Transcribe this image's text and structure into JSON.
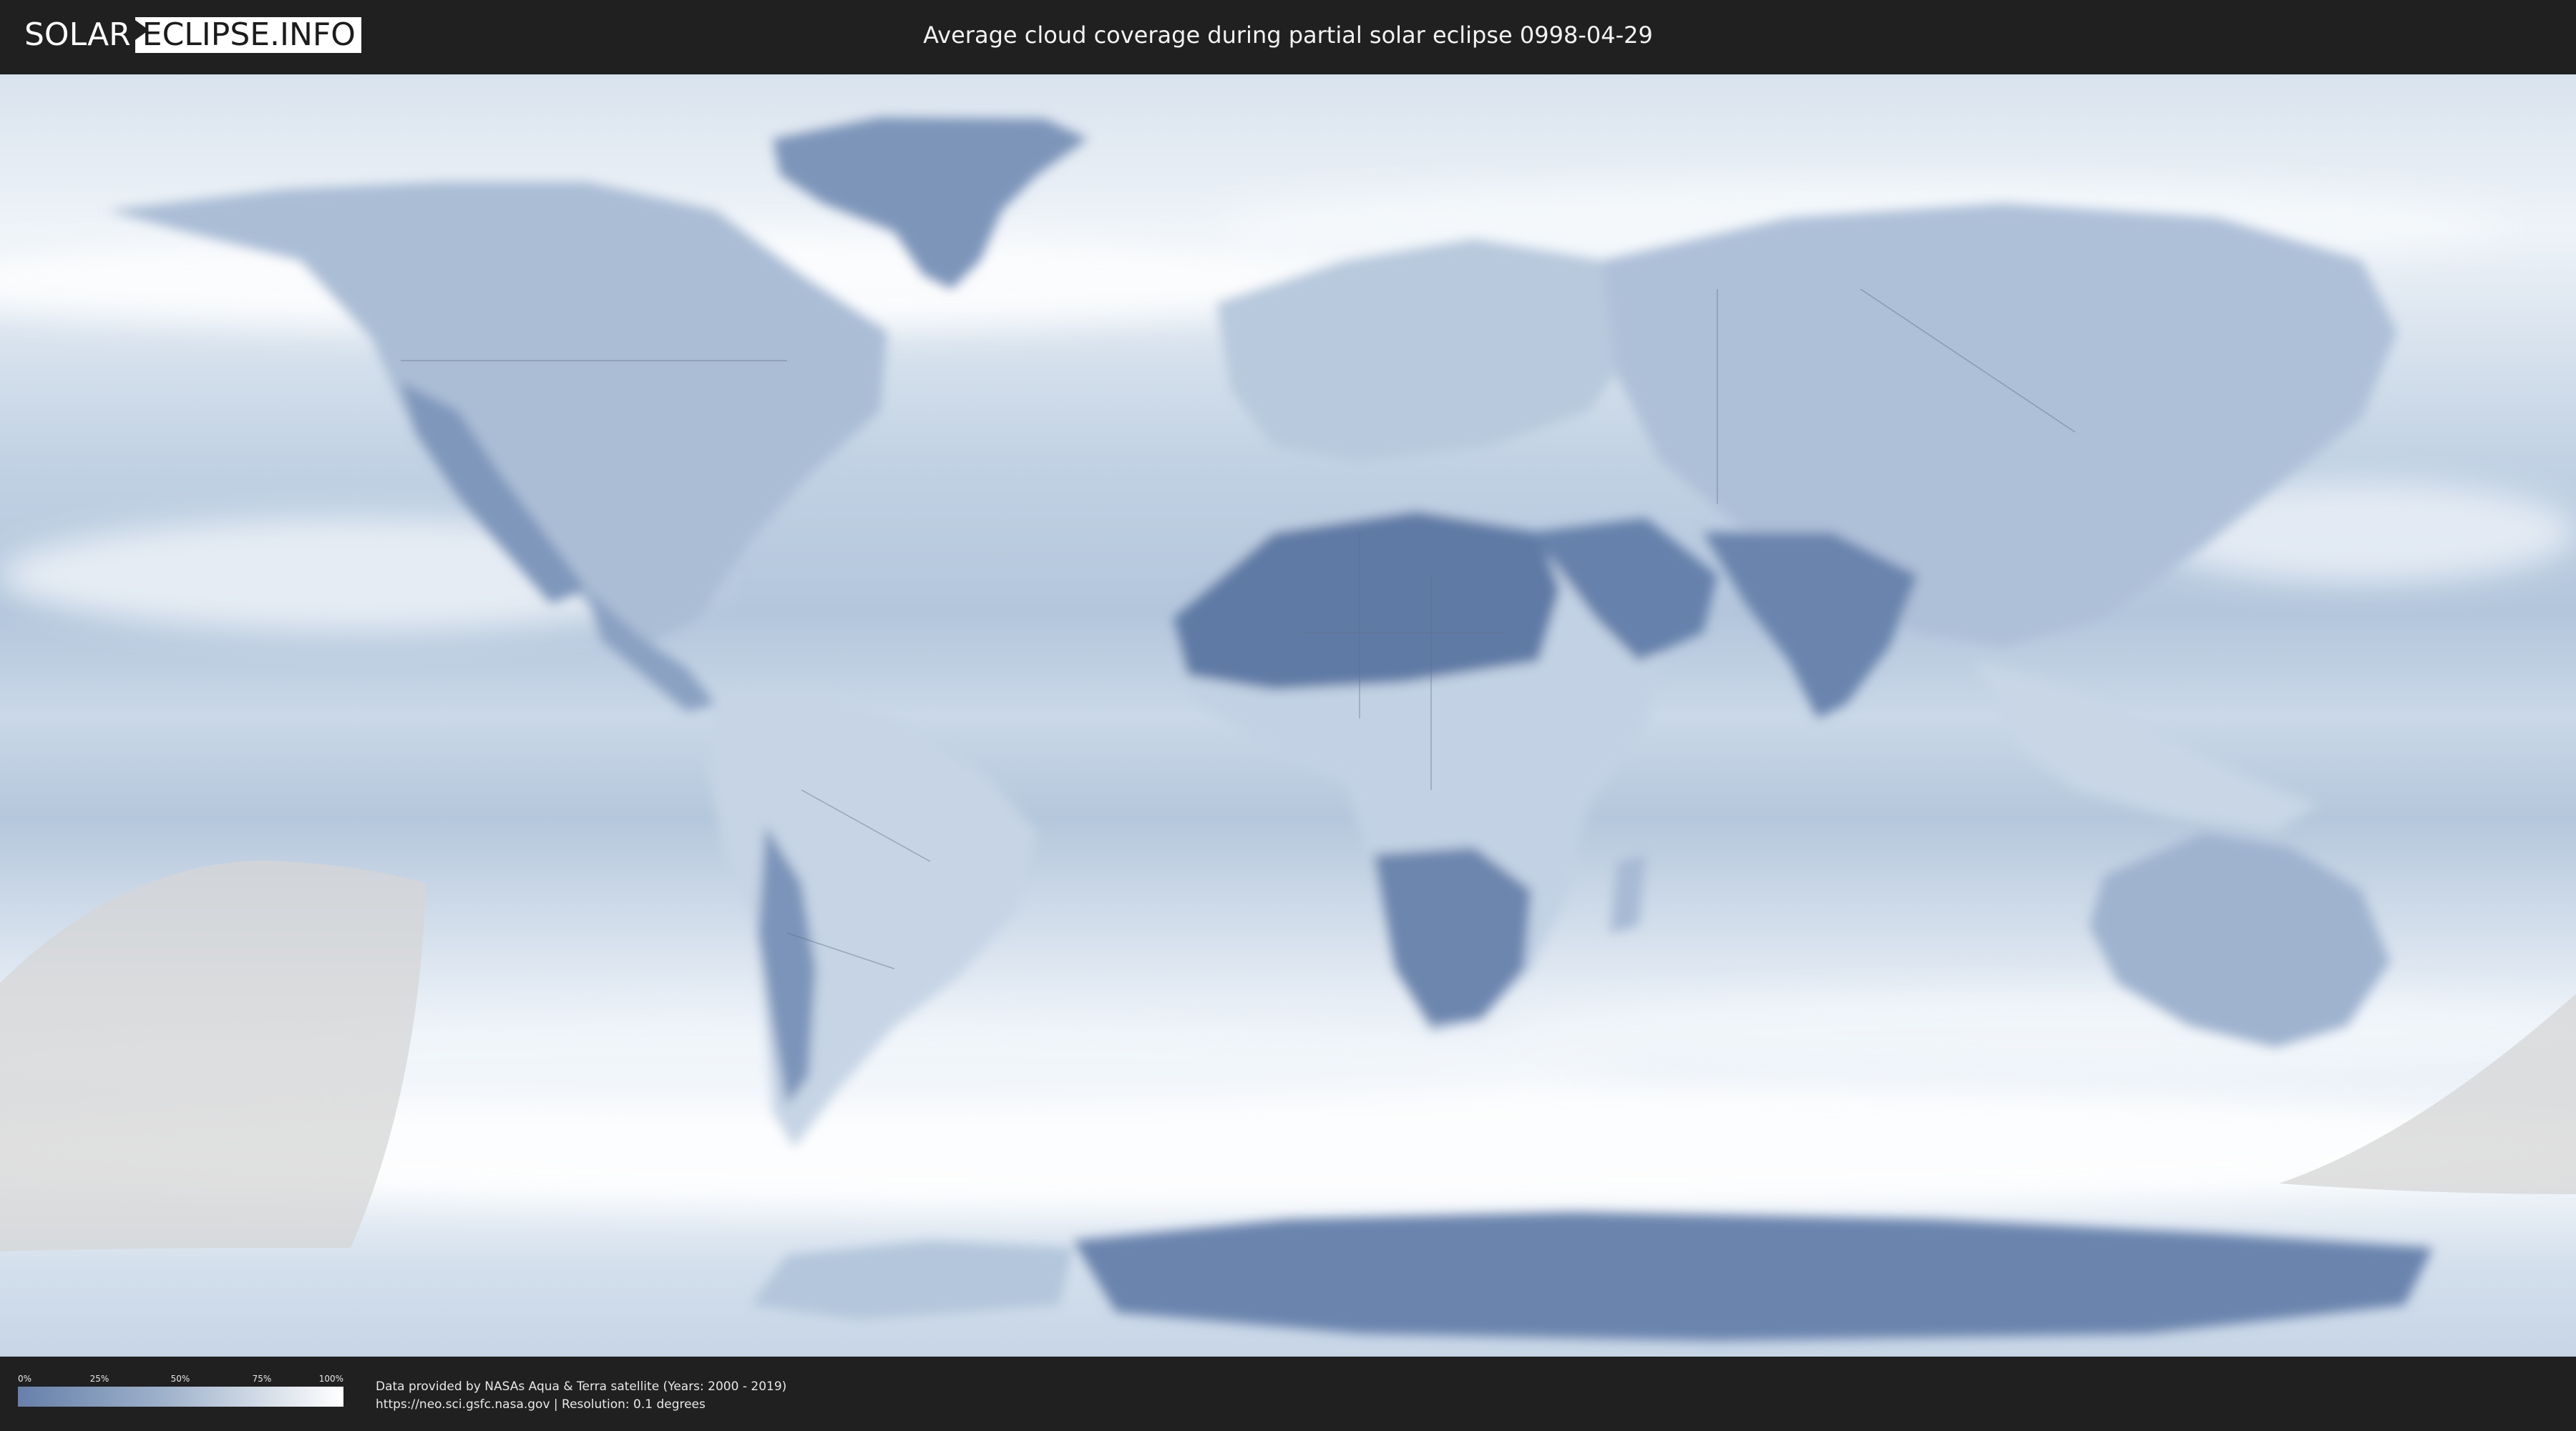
{
  "header": {
    "logo_left": "SOLAR",
    "logo_right": "ECLIPSE.INFO",
    "title": "Average cloud coverage during partial solar eclipse 0998-04-29"
  },
  "legend": {
    "ticks": [
      "0%",
      "25%",
      "50%",
      "75%",
      "100%"
    ],
    "gradient_start": "#6680aa",
    "gradient_end": "#ffffff"
  },
  "credits": {
    "line1": "Data provided by NASAs Aqua & Terra satellite (Years: 2000 - 2019)",
    "line2": "https://neo.sci.gsfc.nasa.gov | Resolution: 0.1 degrees"
  },
  "colors": {
    "background": "#202020",
    "land_clear": "#5d78a3",
    "cloud": "#ffffff",
    "eclipse_zone": "#d8d8d8"
  }
}
